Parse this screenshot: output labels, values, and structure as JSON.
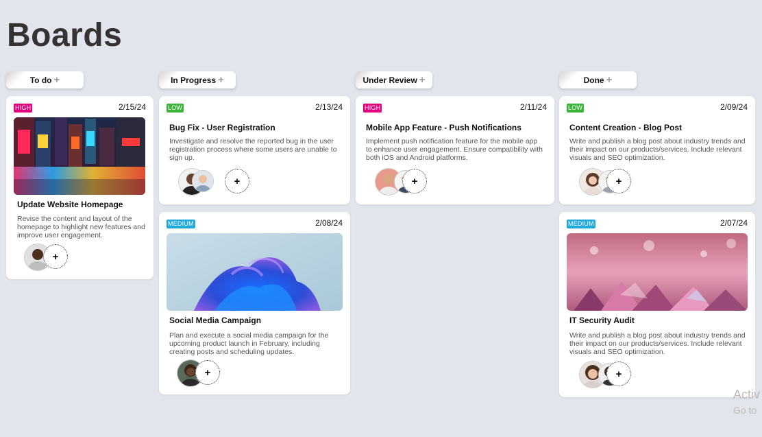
{
  "page": {
    "title": "Boards"
  },
  "colors": {
    "high": "#e3007c",
    "low": "#3cb43c",
    "medium": "#20a9d9"
  },
  "columns": [
    {
      "label": "To do",
      "add": "+"
    },
    {
      "label": "In Progress",
      "add": "+"
    },
    {
      "label": "Under Review",
      "add": "+"
    },
    {
      "label": "Done",
      "add": "+"
    }
  ],
  "cards": {
    "todo1": {
      "priority": "HIGH",
      "date": "2/15/24",
      "title": "Update Website Homepage",
      "description": "Revise the content and layout of the homepage to highlight new features and improve user engagement.",
      "image": "city-night-image",
      "add": "+"
    },
    "progress1": {
      "priority": "LOW",
      "date": "2/13/24",
      "title": "Bug Fix - User Registration",
      "description": "Investigate and resolve the reported bug in the user registration process where some users are unable to sign up.",
      "add": "+"
    },
    "progress2": {
      "priority": "MEDIUM",
      "date": "2/08/24",
      "title": "Social Media Campaign",
      "description": "Plan and execute a social media campaign for the upcoming product launch in February, including creating posts and scheduling updates.",
      "image": "blue-bloom-image",
      "add": "+"
    },
    "review1": {
      "priority": "HIGH",
      "date": "2/11/24",
      "title": "Mobile App Feature - Push Notifications",
      "description": "Implement push notification feature for the mobile app to enhance user engagement. Ensure compatibility with both iOS and Android platforms.",
      "add": "+"
    },
    "done1": {
      "priority": "LOW",
      "date": "2/09/24",
      "title": "Content Creation - Blog Post",
      "description": "Write and publish a blog post about industry trends and their impact on our products/services. Include relevant visuals and SEO optimization.",
      "add": "+"
    },
    "done2": {
      "priority": "MEDIUM",
      "date": "2/07/24",
      "title": "IT Security Audit",
      "description": "Write and publish a blog post about industry trends and their impact on our products/services. Include relevant visuals and SEO optimization.",
      "image": "crystals-image",
      "add": "+"
    }
  },
  "watermark": {
    "line1": "Activ",
    "line2": "Go to"
  }
}
